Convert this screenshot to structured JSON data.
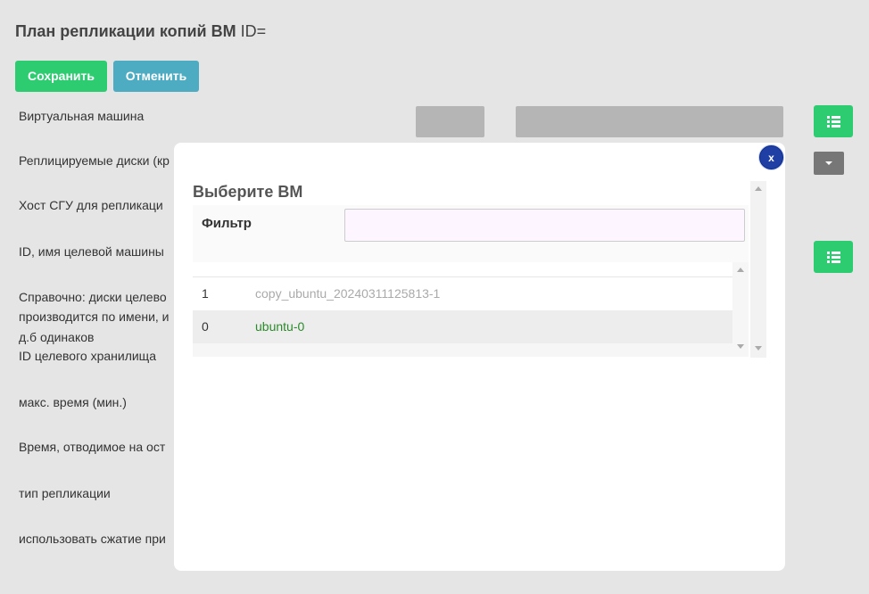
{
  "page": {
    "title": "План репликации копий ВМ",
    "title_suffix": "ID="
  },
  "toolbar": {
    "save_label": "Сохранить",
    "cancel_label": "Отменить"
  },
  "form": {
    "labels": [
      "Виртуальная машина",
      "Реплицируемые диски (кр",
      "Хост СГУ для репликаци",
      "ID, имя целевой машины",
      "Справочно: диски целево",
      "производится по имени, и",
      "д.б одинаков",
      "ID целевого хранилища",
      "макс. время (мин.)",
      "Время, отводимое на ост",
      "тип репликации",
      "использовать сжатие при"
    ]
  },
  "modal": {
    "title": "Выберите ВМ",
    "close_label": "x",
    "filter_label": "Фильтр",
    "filter_value": "",
    "rows": [
      {
        "id": "1",
        "name": "copy_ubuntu_20240311125813-1"
      },
      {
        "id": "0",
        "name": "ubuntu-0"
      }
    ]
  },
  "colors": {
    "save": "#2ecc71",
    "cancel": "#4dabc2",
    "close": "#1f3fa5",
    "row_name_available": "#2a8a2a",
    "row_name_disabled": "#aaaaaa"
  },
  "icons": {
    "list": "list-icon",
    "dropdown": "caret-down-icon",
    "close": "close-icon"
  }
}
